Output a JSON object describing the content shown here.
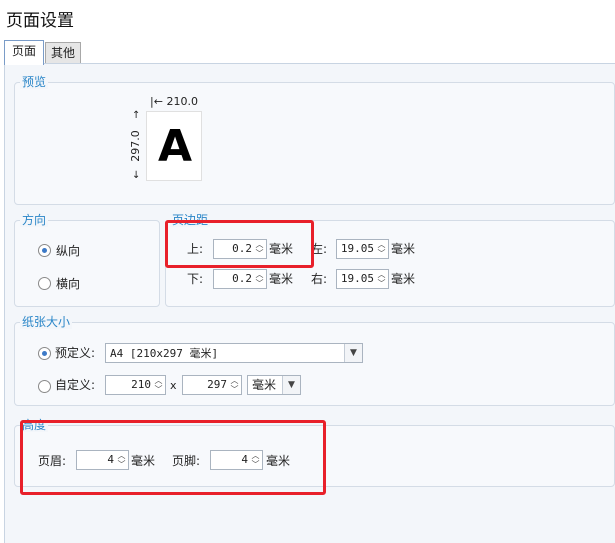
{
  "title": "页面设置",
  "tabs": [
    {
      "label": "页面",
      "active": true
    },
    {
      "label": "其他",
      "active": false
    }
  ],
  "preview": {
    "legend": "预览",
    "width_label": "210.0",
    "height_label": "297.0",
    "letter": "A"
  },
  "orientation": {
    "legend": "方向",
    "portrait_label": "纵向",
    "landscape_label": "横向",
    "selected": "portrait"
  },
  "margins": {
    "legend": "页边距",
    "top_label": "上:",
    "top_value": "0.2",
    "bottom_label": "下:",
    "bottom_value": "0.2",
    "left_label": "左:",
    "left_value": "19.05",
    "right_label": "右:",
    "right_value": "19.05",
    "unit": "毫米"
  },
  "paper": {
    "legend": "纸张大小",
    "predefined_label": "预定义:",
    "predefined_value": "A4 [210x297 毫米]",
    "custom_label": "自定义:",
    "custom_width": "210",
    "times": "x",
    "custom_height": "297",
    "custom_unit": "毫米",
    "selected": "predefined"
  },
  "height": {
    "legend": "高度",
    "header_label": "页眉:",
    "header_value": "4",
    "footer_label": "页脚:",
    "footer_value": "4",
    "unit": "毫米"
  },
  "colors": {
    "accent": "#2a86c8",
    "highlight": "#e8202a"
  }
}
